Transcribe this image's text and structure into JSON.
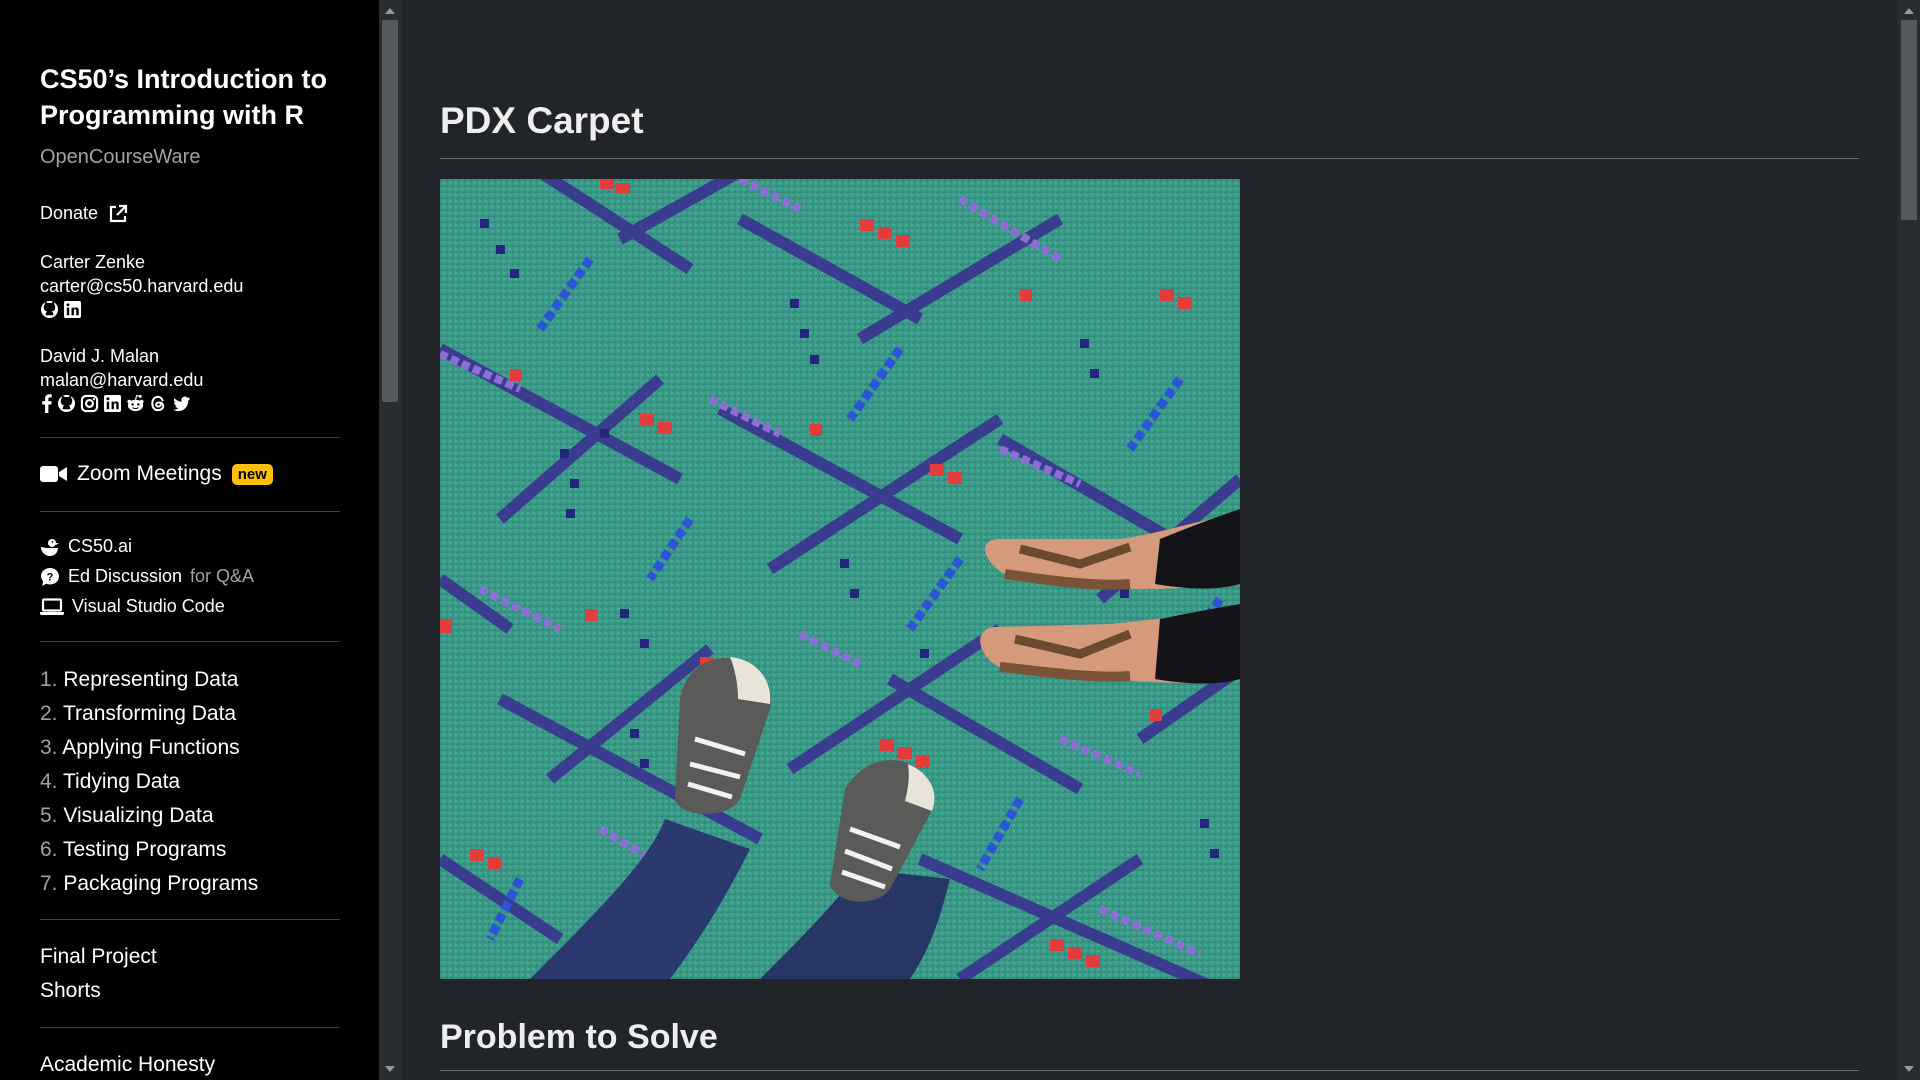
{
  "sidebar": {
    "title": "CS50’s Introduction to Programming with R",
    "subtitle": "OpenCourseWare",
    "donate_label": "Donate",
    "people": [
      {
        "name": "Carter Zenke",
        "email": "carter@cs50.harvard.edu",
        "icons": [
          "github-icon",
          "linkedin-icon"
        ]
      },
      {
        "name": "David J. Malan",
        "email": "malan@harvard.edu",
        "icons": [
          "facebook-icon",
          "github-icon",
          "instagram-icon",
          "linkedin-icon",
          "reddit-icon",
          "threads-icon",
          "twitter-icon"
        ]
      }
    ],
    "zoom": {
      "label": "Zoom Meetings",
      "badge": "new"
    },
    "tools": [
      {
        "label": "CS50.ai",
        "suffix": ""
      },
      {
        "label": "Ed Discussion",
        "suffix": "for Q&A"
      },
      {
        "label": "Visual Studio Code",
        "suffix": ""
      }
    ],
    "lectures": [
      {
        "num": "1.",
        "label": "Representing Data"
      },
      {
        "num": "2.",
        "label": "Transforming Data"
      },
      {
        "num": "3.",
        "label": "Applying Functions"
      },
      {
        "num": "4.",
        "label": "Tidying Data"
      },
      {
        "num": "5.",
        "label": "Visualizing Data"
      },
      {
        "num": "6.",
        "label": "Testing Programs"
      },
      {
        "num": "7.",
        "label": "Packaging Programs"
      }
    ],
    "extras": [
      "Final Project",
      "Shorts"
    ],
    "bottom": [
      "Academic Honesty"
    ]
  },
  "main": {
    "title": "PDX Carpet",
    "section_title": "Problem to Solve"
  },
  "colors": {
    "sidebar_bg": "#000000",
    "main_bg": "#212529",
    "badge": "#ffc107",
    "carpet": "#3a9a88"
  }
}
